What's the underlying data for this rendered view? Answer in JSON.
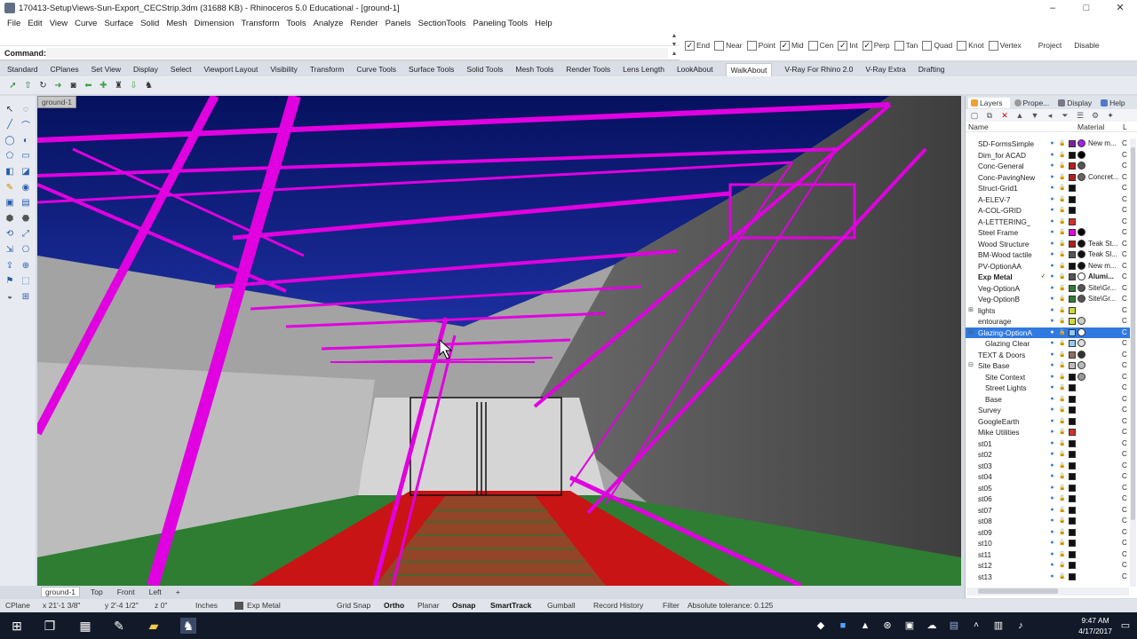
{
  "window": {
    "title": "170413-SetupViews-Sun-Export_CECStrip.3dm (31688 KB) - Rhinoceros 5.0 Educational - [ground-1]",
    "controls": [
      "–",
      "□",
      "✕"
    ]
  },
  "menu": [
    "File",
    "Edit",
    "View",
    "Curve",
    "Surface",
    "Solid",
    "Mesh",
    "Dimension",
    "Transform",
    "Tools",
    "Analyze",
    "Render",
    "Panels",
    "SectionTools",
    "Paneling Tools",
    "Help"
  ],
  "command": {
    "prompt": "Command:",
    "value": ""
  },
  "osnap": {
    "items": [
      {
        "label": "End",
        "checked": true
      },
      {
        "label": "Near",
        "checked": false
      },
      {
        "label": "Point",
        "checked": false
      },
      {
        "label": "Mid",
        "checked": true
      },
      {
        "label": "Cen",
        "checked": false
      },
      {
        "label": "Int",
        "checked": true
      },
      {
        "label": "Perp",
        "checked": true
      },
      {
        "label": "Tan",
        "checked": false
      },
      {
        "label": "Quad",
        "checked": false
      },
      {
        "label": "Knot",
        "checked": false
      },
      {
        "label": "Vertex",
        "checked": false
      }
    ],
    "project": "Project",
    "disable": "Disable"
  },
  "toolbar_tabs": [
    "Standard",
    "CPlanes",
    "Set View",
    "Display",
    "Select",
    "Viewport Layout",
    "Visibility",
    "Transform",
    "Curve Tools",
    "Surface Tools",
    "Solid Tools",
    "Mesh Tools",
    "Render Tools",
    "Lens Length",
    "LookAbout",
    "WalkAbout",
    "V-Ray For Rhino 2.0",
    "V-Ray Extra",
    "Drafting"
  ],
  "active_tab": "WalkAbout",
  "viewport": {
    "title": "ground-1"
  },
  "viewport_tabs": [
    "ground-1",
    "Top",
    "Front",
    "Left",
    "+"
  ],
  "panel": {
    "tabs": [
      "Layers",
      "Prope...",
      "Display",
      "Help"
    ],
    "header": {
      "name": "Name",
      "material": "Material",
      "extra": "L"
    }
  },
  "layers": [
    {
      "name": "SD-FormsSimple",
      "color": "#7b1fa2",
      "mat": "#a020f0",
      "mat_name": "New m...",
      "current": false,
      "sel": false,
      "indent": 0
    },
    {
      "name": "Dim_for ACAD",
      "color": "#111111",
      "mat": "#000000",
      "mat_name": "",
      "current": false,
      "sel": false,
      "indent": 0
    },
    {
      "name": "Conc-General",
      "color": "#b71c1c",
      "mat": "#555555",
      "mat_name": "",
      "current": false,
      "sel": false,
      "indent": 0
    },
    {
      "name": "Conc-PavingNew",
      "color": "#b71c1c",
      "mat": "#666666",
      "mat_name": "Concret...",
      "current": false,
      "sel": false,
      "indent": 0
    },
    {
      "name": "Struct-Grid1",
      "color": "#111111",
      "mat": "",
      "mat_name": "",
      "current": false,
      "sel": false,
      "indent": 0
    },
    {
      "name": "A-ELEV-7",
      "color": "#111111",
      "mat": "",
      "mat_name": "",
      "current": false,
      "sel": false,
      "indent": 0
    },
    {
      "name": "A-COL-GRID",
      "color": "#111111",
      "mat": "",
      "mat_name": "",
      "current": false,
      "sel": false,
      "indent": 0
    },
    {
      "name": "A-LETTERING_",
      "color": "#d32f2f",
      "mat": "",
      "mat_name": "",
      "current": false,
      "sel": false,
      "indent": 0
    },
    {
      "name": "Steel Frame",
      "color": "#e000e0",
      "mat": "#000000",
      "mat_name": "",
      "current": false,
      "sel": false,
      "indent": 0
    },
    {
      "name": "Wood Structure",
      "color": "#b71c1c",
      "mat": "#111111",
      "mat_name": "Teak St...",
      "current": false,
      "sel": false,
      "indent": 0
    },
    {
      "name": "BM-Wood tactile",
      "color": "#555555",
      "mat": "#111111",
      "mat_name": "Teak Sl...",
      "current": false,
      "sel": false,
      "indent": 0
    },
    {
      "name": "PV-OptionAA",
      "color": "#111111",
      "mat": "#111111",
      "mat_name": "New m...",
      "current": false,
      "sel": false,
      "indent": 0
    },
    {
      "name": "Exp Metal",
      "color": "#555555",
      "mat": "#ffffff",
      "mat_name": "Alumi...",
      "current": true,
      "sel": false,
      "indent": 0
    },
    {
      "name": "Veg-OptionA",
      "color": "#2e7d32",
      "mat": "#555555",
      "mat_name": "Site\\Gr...",
      "current": false,
      "sel": false,
      "indent": 0
    },
    {
      "name": "Veg-OptionB",
      "color": "#2e7d32",
      "mat": "#555555",
      "mat_name": "Site\\Gr...",
      "current": false,
      "sel": false,
      "indent": 0
    },
    {
      "name": "lights",
      "color": "#cddc39",
      "mat": "",
      "mat_name": "",
      "current": false,
      "sel": false,
      "indent": 0,
      "expand": "+"
    },
    {
      "name": "entourage",
      "color": "#cddc39",
      "mat": "#cccccc",
      "mat_name": "",
      "current": false,
      "sel": false,
      "indent": 0
    },
    {
      "name": "Glazing-OptionA",
      "color": "#90caf9",
      "mat": "#ffffff",
      "mat_name": "",
      "current": false,
      "sel": true,
      "indent": 0,
      "expand": "−"
    },
    {
      "name": "Glazing Clear",
      "color": "#90caf9",
      "mat": "#dddddd",
      "mat_name": "",
      "current": false,
      "sel": false,
      "indent": 1
    },
    {
      "name": "TEXT & Doors",
      "color": "#8d6e63",
      "mat": "#333333",
      "mat_name": "",
      "current": false,
      "sel": false,
      "indent": 0
    },
    {
      "name": "Site Base",
      "color": "#bdbdbd",
      "mat": "#bbbbbb",
      "mat_name": "",
      "current": false,
      "sel": false,
      "indent": 0,
      "expand": "−"
    },
    {
      "name": "Site Context",
      "color": "#111111",
      "mat": "#999999",
      "mat_name": "",
      "current": false,
      "sel": false,
      "indent": 1
    },
    {
      "name": "Street Lights",
      "color": "#111111",
      "mat": "",
      "mat_name": "",
      "current": false,
      "sel": false,
      "indent": 1
    },
    {
      "name": "Base",
      "color": "#111111",
      "mat": "",
      "mat_name": "",
      "current": false,
      "sel": false,
      "indent": 1
    },
    {
      "name": "Survey",
      "color": "#111111",
      "mat": "",
      "mat_name": "",
      "current": false,
      "sel": false,
      "indent": 0
    },
    {
      "name": "GoogleEarth",
      "color": "#111111",
      "mat": "",
      "mat_name": "",
      "current": false,
      "sel": false,
      "indent": 0
    },
    {
      "name": "Mike Utilities",
      "color": "#d32f2f",
      "mat": "",
      "mat_name": "",
      "current": false,
      "sel": false,
      "indent": 0
    },
    {
      "name": "st01",
      "color": "#111111",
      "mat": "",
      "mat_name": "",
      "current": false,
      "sel": false,
      "indent": 0
    },
    {
      "name": "st02",
      "color": "#111111",
      "mat": "",
      "mat_name": "",
      "current": false,
      "sel": false,
      "indent": 0
    },
    {
      "name": "st03",
      "color": "#111111",
      "mat": "",
      "mat_name": "",
      "current": false,
      "sel": false,
      "indent": 0
    },
    {
      "name": "st04",
      "color": "#111111",
      "mat": "",
      "mat_name": "",
      "current": false,
      "sel": false,
      "indent": 0
    },
    {
      "name": "st05",
      "color": "#111111",
      "mat": "",
      "mat_name": "",
      "current": false,
      "sel": false,
      "indent": 0
    },
    {
      "name": "st06",
      "color": "#111111",
      "mat": "",
      "mat_name": "",
      "current": false,
      "sel": false,
      "indent": 0
    },
    {
      "name": "st07",
      "color": "#111111",
      "mat": "",
      "mat_name": "",
      "current": false,
      "sel": false,
      "indent": 0
    },
    {
      "name": "st08",
      "color": "#111111",
      "mat": "",
      "mat_name": "",
      "current": false,
      "sel": false,
      "indent": 0
    },
    {
      "name": "st09",
      "color": "#111111",
      "mat": "",
      "mat_name": "",
      "current": false,
      "sel": false,
      "indent": 0
    },
    {
      "name": "st10",
      "color": "#111111",
      "mat": "",
      "mat_name": "",
      "current": false,
      "sel": false,
      "indent": 0
    },
    {
      "name": "st11",
      "color": "#111111",
      "mat": "",
      "mat_name": "",
      "current": false,
      "sel": false,
      "indent": 0
    },
    {
      "name": "st12",
      "color": "#111111",
      "mat": "",
      "mat_name": "",
      "current": false,
      "sel": false,
      "indent": 0
    },
    {
      "name": "st13",
      "color": "#111111",
      "mat": "",
      "mat_name": "",
      "current": false,
      "sel": false,
      "indent": 0
    }
  ],
  "status": {
    "cplane": "CPlane",
    "x": "x 21'-1 3/8\"",
    "y": "y 2'-4 1/2\"",
    "z": "z 0\"",
    "units": "Inches",
    "layer": "Exp Metal",
    "grid_snap": "Grid Snap",
    "ortho": "Ortho",
    "planar": "Planar",
    "osnap": "Osnap",
    "smarttrack": "SmartTrack",
    "gumball": "Gumball",
    "record_history": "Record History",
    "filter": "Filter",
    "tolerance": "Absolute tolerance: 0.125"
  },
  "taskbar": {
    "time": "9:47 AM",
    "date": "4/17/2017"
  },
  "colors": {
    "steel": "#e000e0",
    "sky": "#0a1a78",
    "ground_green": "#2e7d32",
    "path_red": "#d01010",
    "selection": "#3079e0"
  }
}
